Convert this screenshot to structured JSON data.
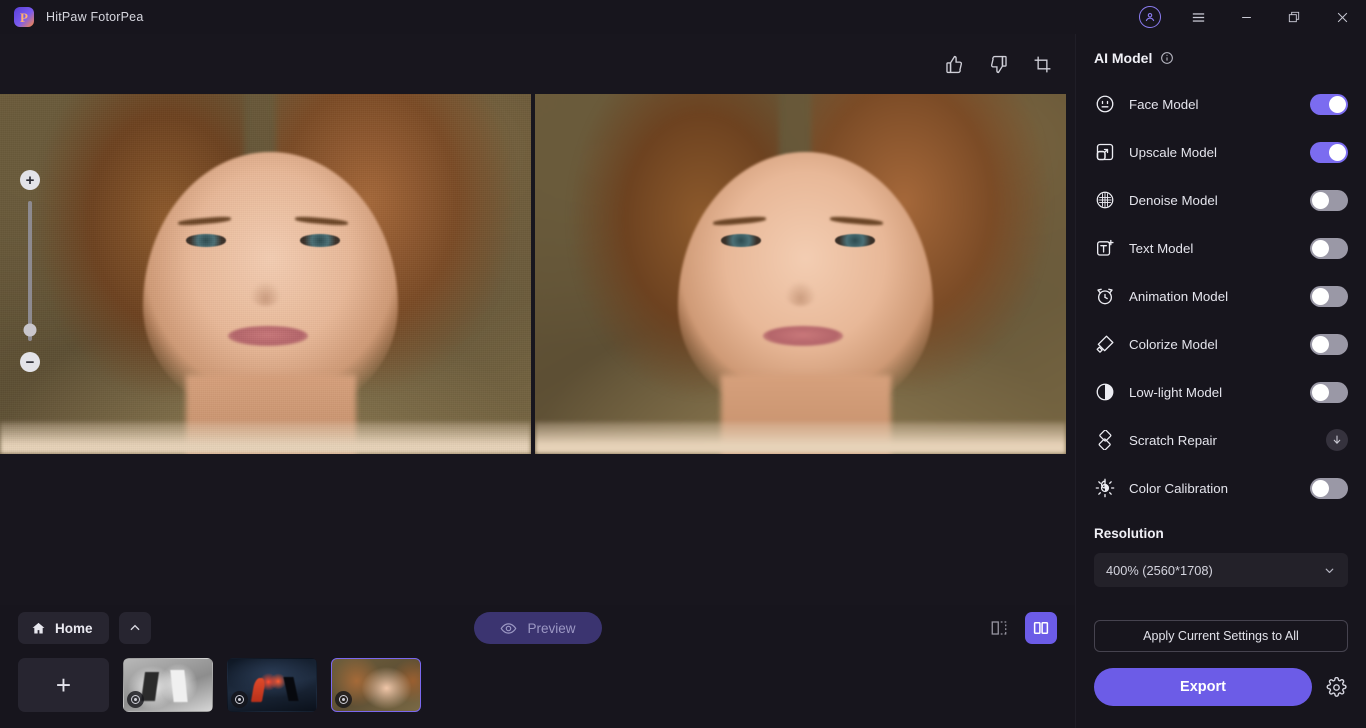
{
  "window": {
    "title": "HitPaw FotorPea",
    "logo_icon": "hitpaw-logo",
    "controls": {
      "account_icon": "account-circle-icon",
      "menu_icon": "hamburger-menu-icon",
      "minimize_icon": "minimize-icon",
      "restore_icon": "restore-icon",
      "close_icon": "close-icon"
    }
  },
  "canvas": {
    "toolbar": {
      "thumbs_up_icon": "thumbs-up-icon",
      "thumbs_down_icon": "thumbs-down-icon",
      "crop_icon": "crop-icon"
    },
    "zoom": {
      "zoom_in_label": "+",
      "zoom_out_label": "−",
      "slider_position_percent": 92
    },
    "before_label": "",
    "after_label": ""
  },
  "bottom": {
    "home_label": "Home",
    "home_icon": "home-icon",
    "collapse_icon": "chevron-up-icon",
    "preview_label": "Preview",
    "preview_icon": "eye-icon",
    "add_label": "+",
    "view_modes": [
      {
        "name": "split-view",
        "icon": "split-view-icon",
        "active": false
      },
      {
        "name": "side-by-side-view",
        "icon": "side-by-side-icon",
        "active": true
      }
    ],
    "thumbnails": [
      {
        "name": "thumbnail-1",
        "selected": false,
        "badge_icon": "status-circle-icon"
      },
      {
        "name": "thumbnail-2",
        "selected": false,
        "badge_icon": "status-circle-icon"
      },
      {
        "name": "thumbnail-3",
        "selected": true,
        "badge_icon": "status-circle-icon"
      }
    ]
  },
  "panel": {
    "title": "AI Model",
    "info_icon": "info-icon",
    "models": [
      {
        "label": "Face Model",
        "icon": "face-model-icon",
        "control": "toggle",
        "on": true
      },
      {
        "label": "Upscale Model",
        "icon": "upscale-model-icon",
        "control": "toggle",
        "on": true
      },
      {
        "label": "Denoise Model",
        "icon": "denoise-model-icon",
        "control": "toggle",
        "on": false
      },
      {
        "label": "Text Model",
        "icon": "text-model-icon",
        "control": "toggle",
        "on": false
      },
      {
        "label": "Animation Model",
        "icon": "animation-model-icon",
        "control": "toggle",
        "on": false
      },
      {
        "label": "Colorize Model",
        "icon": "colorize-model-icon",
        "control": "toggle",
        "on": false
      },
      {
        "label": "Low-light Model",
        "icon": "lowlight-model-icon",
        "control": "toggle",
        "on": false
      },
      {
        "label": "Scratch Repair",
        "icon": "scratch-repair-icon",
        "control": "download",
        "on": false
      },
      {
        "label": "Color Calibration",
        "icon": "color-calibration-icon",
        "control": "toggle",
        "on": false
      }
    ],
    "resolution": {
      "title": "Resolution",
      "value": "400% (2560*1708)",
      "chevron_icon": "chevron-down-icon"
    },
    "apply_label": "Apply Current Settings to All",
    "export_label": "Export",
    "settings_icon": "gear-icon"
  },
  "colors": {
    "accent": "#6c5ce7",
    "toggle_on": "#7b6cf0",
    "toggle_off": "#9a98a6",
    "panel_bg": "#17151d",
    "canvas_bg": "#18161e"
  }
}
